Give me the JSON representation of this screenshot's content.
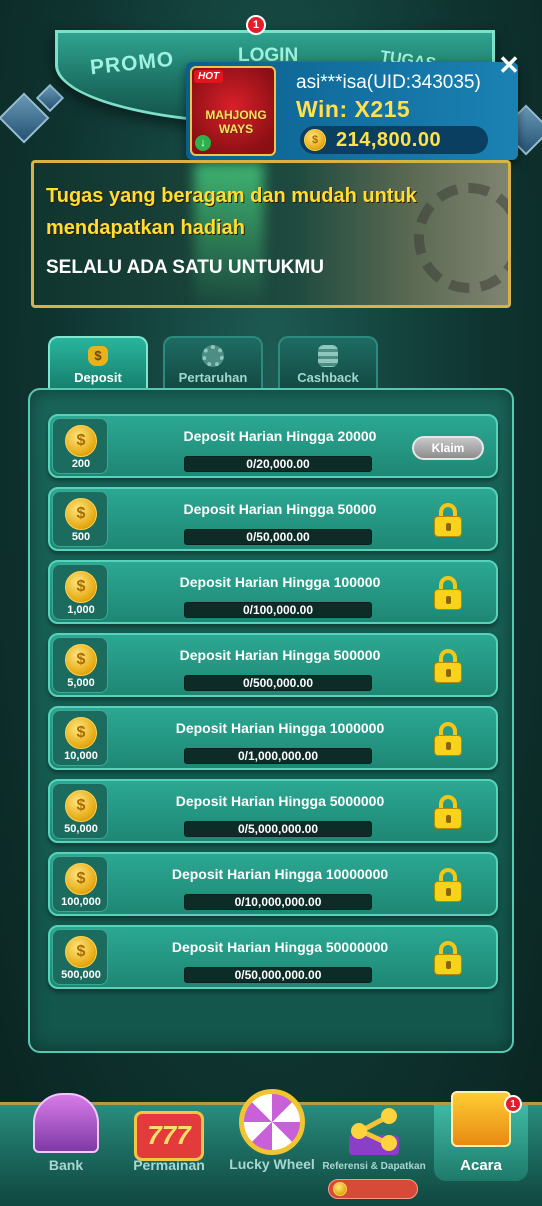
{
  "top_tabs": {
    "promo": "PROMO",
    "login": "LOGIN",
    "tugas": "TUGAS",
    "login_badge": "1"
  },
  "win_popup": {
    "hot_tag": "HOT",
    "game_name": "MAHJONG WAYS",
    "user": "asi***isa(UID:343035)",
    "win": "Win: X215",
    "balance": "214,800.00",
    "close_icon": "close-icon"
  },
  "banner": {
    "line1": "Tugas yang beragam dan mudah untuk",
    "line2": "mendapatkan hadiah",
    "line3": "SELALU ADA SATU UNTUKMU"
  },
  "category_tabs": [
    {
      "label": "Deposit",
      "icon": "money-bag-icon",
      "active": true
    },
    {
      "label": "Pertaruhan",
      "icon": "chip-icon",
      "active": false
    },
    {
      "label": "Cashback",
      "icon": "coin-stack-icon",
      "active": false
    }
  ],
  "tasks": [
    {
      "title": "Deposit Harian Hingga 20000",
      "reward": "200",
      "progress": "0/20,000.00",
      "progress_fraction": 0,
      "state": "claim",
      "claim_label": "Klaim"
    },
    {
      "title": "Deposit Harian Hingga 50000",
      "reward": "500",
      "progress": "0/50,000.00",
      "progress_fraction": 0,
      "state": "locked"
    },
    {
      "title": "Deposit Harian Hingga 100000",
      "reward": "1,000",
      "progress": "0/100,000.00",
      "progress_fraction": 0,
      "state": "locked"
    },
    {
      "title": "Deposit Harian Hingga 500000",
      "reward": "5,000",
      "progress": "0/500,000.00",
      "progress_fraction": 0,
      "state": "locked"
    },
    {
      "title": "Deposit Harian Hingga 1000000",
      "reward": "10,000",
      "progress": "0/1,000,000.00",
      "progress_fraction": 0,
      "state": "locked"
    },
    {
      "title": "Deposit Harian Hingga 5000000",
      "reward": "50,000",
      "progress": "0/5,000,000.00",
      "progress_fraction": 0,
      "state": "locked"
    },
    {
      "title": "Deposit Harian Hingga 10000000",
      "reward": "100,000",
      "progress": "0/10,000,000.00",
      "progress_fraction": 0,
      "state": "locked"
    },
    {
      "title": "Deposit Harian Hingga 50000000",
      "reward": "500,000",
      "progress": "0/50,000,000.00",
      "progress_fraction": 0,
      "state": "locked"
    }
  ],
  "bottom_nav": {
    "bank": "Bank",
    "permainan": "Permainan",
    "lucky_wheel": "Lucky Wheel",
    "referensi": "Referensi & Dapatkan",
    "acara": "Acara",
    "acara_badge": "1",
    "slot_text": "777"
  },
  "colors": {
    "accent_gold": "#ffde33",
    "teal": "#2ba893",
    "lock": "#f9d21c"
  }
}
